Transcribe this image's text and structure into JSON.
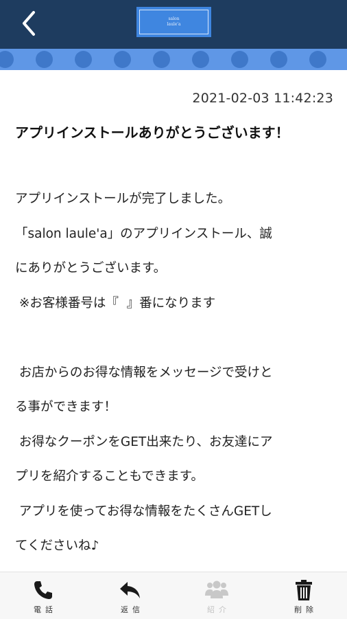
{
  "header": {
    "back_icon": "chevron-left-icon",
    "logo_line1": "salon",
    "logo_line2": "laule'a"
  },
  "colors": {
    "header_bg": "#1e3c5f",
    "band_bg": "#5f97e6",
    "band_dots": "#3f78c9",
    "logo_bg": "#3f86e0"
  },
  "message": {
    "timestamp": "2021-02-03 11:42:23",
    "title": "アプリインストールありがとうございます！",
    "body_lines": [
      "アプリインストールが完了しました。",
      "「salon laule'a」のアプリインストール、誠",
      "にありがとうございます。",
      " ※お客様番号は『  』番になります",
      "",
      " お店からのお得な情報をメッセージで受けと",
      "る事ができます！",
      " お得なクーポンをGET出来たり、お友達にア",
      "プリを紹介することもできます。",
      " アプリを使ってお得な情報をたくさんGETし",
      "てくださいね♪"
    ]
  },
  "tabbar": {
    "items": [
      {
        "label": "電話",
        "icon": "phone-icon",
        "enabled": true
      },
      {
        "label": "返信",
        "icon": "reply-icon",
        "enabled": true
      },
      {
        "label": "紹介",
        "icon": "group-icon",
        "enabled": false
      },
      {
        "label": "削除",
        "icon": "trash-icon",
        "enabled": true
      }
    ]
  }
}
